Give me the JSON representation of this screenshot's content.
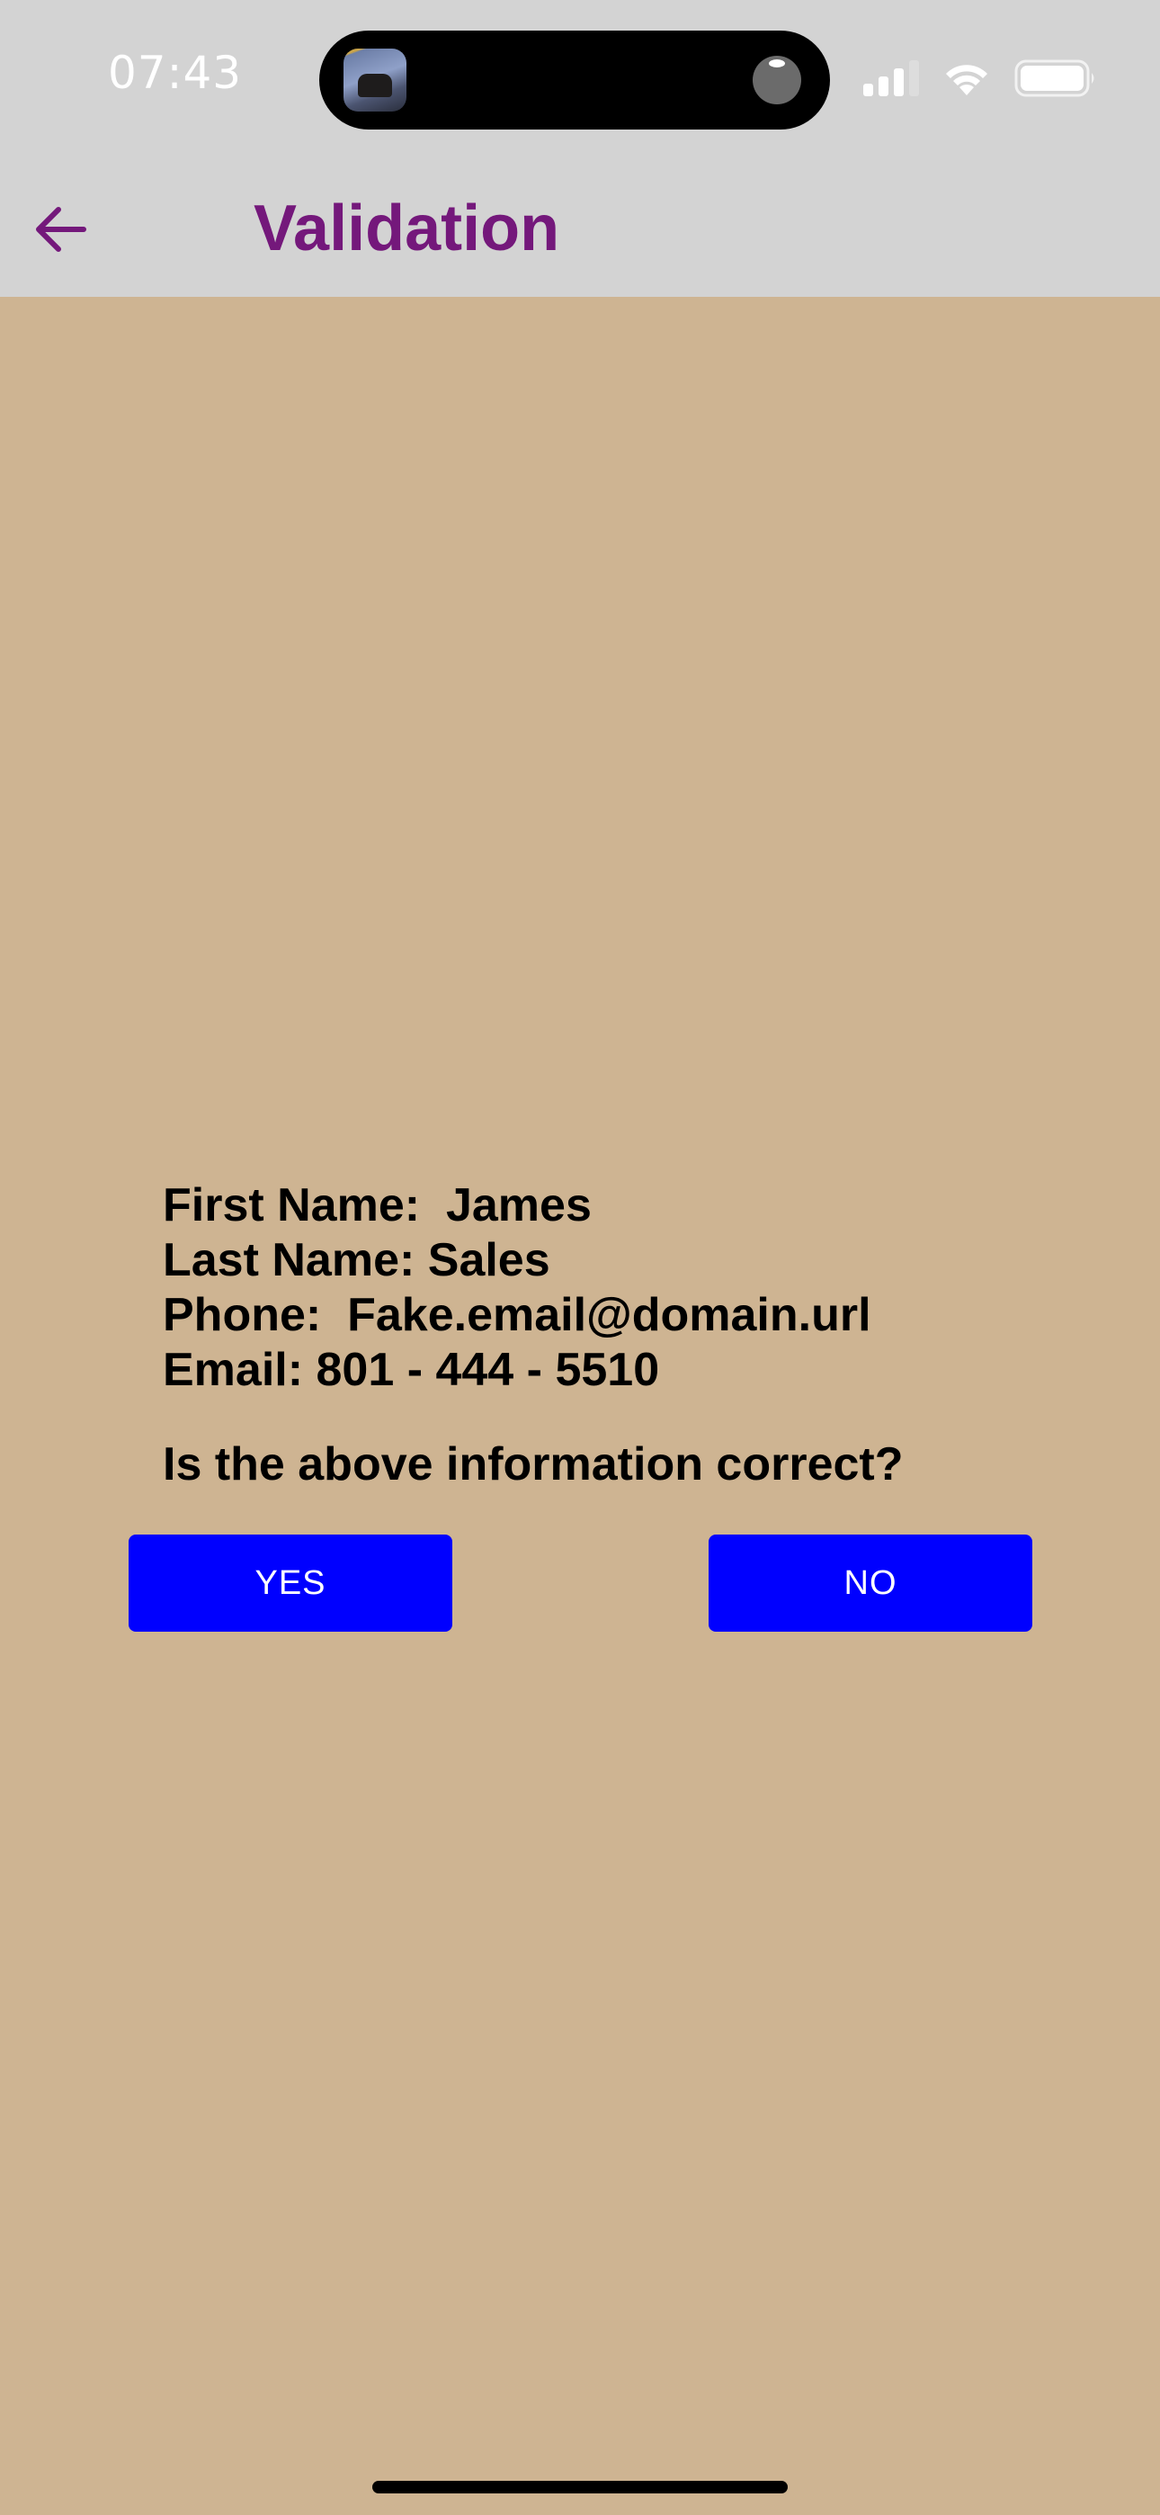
{
  "status_bar": {
    "time": "07:43",
    "icons": [
      "live-activity-app-icon",
      "live-activity-indicator-icon",
      "cellular-signal-icon",
      "wifi-icon",
      "battery-icon"
    ]
  },
  "header": {
    "back_icon": "arrow-left-icon",
    "title": "Validation",
    "title_color": "#74187B",
    "background": "#D3D3D3"
  },
  "info": {
    "lines": [
      "First Name:  James",
      "Last Name: Sales",
      "Phone:  Fake.email@domain.url",
      "Email: 801 - 444 - 5510"
    ]
  },
  "question": "Is the above information correct?",
  "buttons": {
    "yes_label": "YES",
    "no_label": "NO",
    "color": "#0000FF"
  },
  "page_background": "#CEB492"
}
